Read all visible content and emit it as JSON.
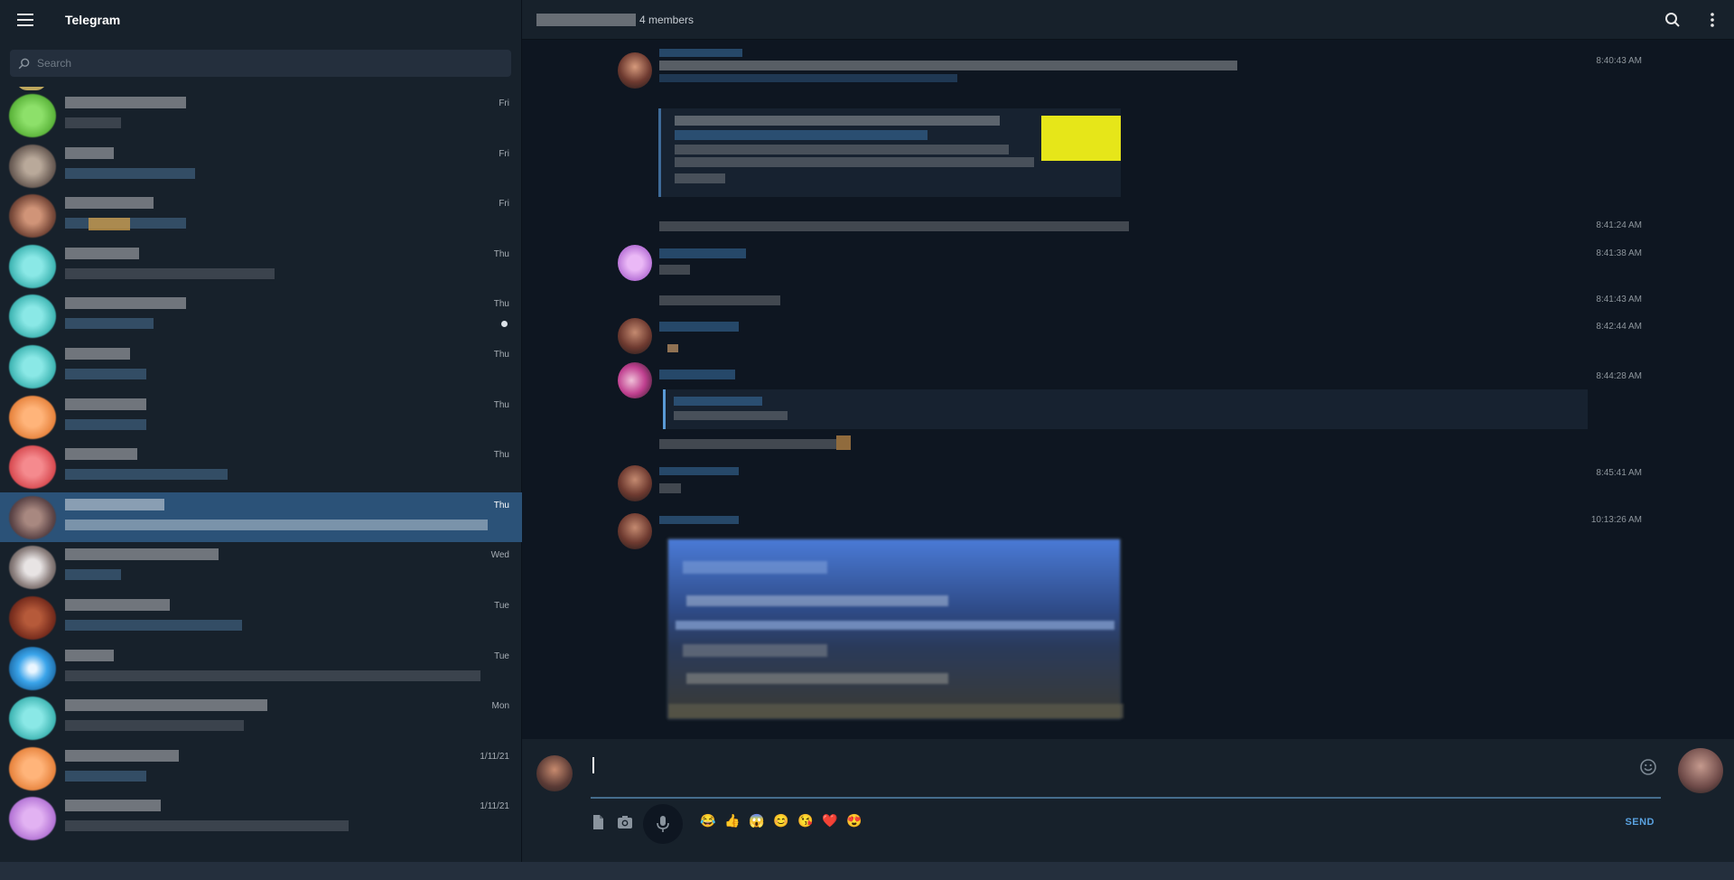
{
  "app": {
    "title": "Telegram"
  },
  "search": {
    "placeholder": "Search"
  },
  "chats": [
    {
      "time": "Fri",
      "avatar": "#6cc24a"
    },
    {
      "time": "Fri",
      "avatar": "#8a7a6e"
    },
    {
      "time": "Fri",
      "avatar": "#a86e58"
    },
    {
      "time": "Thu",
      "avatar": "#59c6c6"
    },
    {
      "time": "Thu",
      "avatar": "#59c6c6",
      "unread": true
    },
    {
      "time": "Thu",
      "avatar": "#59c6c6"
    },
    {
      "time": "Thu",
      "avatar": "#f3975a"
    },
    {
      "time": "Thu",
      "avatar": "#e56267"
    },
    {
      "time": "Thu",
      "avatar": "#6e5658",
      "active": true
    },
    {
      "time": "Wed",
      "avatar": "#9a8c8a"
    },
    {
      "time": "Tue",
      "avatar": "#8a3a2a"
    },
    {
      "time": "Tue",
      "avatar": "#3a9ee0"
    },
    {
      "time": "Mon",
      "avatar": "#59c6c6"
    },
    {
      "time": "1/11/21",
      "avatar": "#f3975a"
    },
    {
      "time": "1/11/21",
      "avatar": "#c79ae0"
    }
  ],
  "header": {
    "members": "4 members"
  },
  "messages": {
    "times": [
      "8:40:43 AM",
      "8:41:24 AM",
      "8:41:38 AM",
      "8:41:43 AM",
      "8:42:44 AM",
      "8:44:28 AM",
      "8:45:41 AM",
      "10:13:26 AM"
    ]
  },
  "composer": {
    "placeholder": "",
    "send_label": "SEND",
    "emojis": [
      "😂",
      "👍",
      "😱",
      "😊",
      "😘",
      "❤️",
      "😍"
    ]
  },
  "icons": {
    "menu": "menu-icon",
    "search": "search-icon",
    "more": "more-vertical-icon",
    "attach": "file-icon",
    "camera": "camera-icon",
    "mic": "microphone-icon",
    "emoji": "smile-icon"
  },
  "colors": {
    "accent": "#2b5278",
    "send": "#5aa2e0",
    "background": "#0e1621",
    "panel": "#17212b"
  }
}
